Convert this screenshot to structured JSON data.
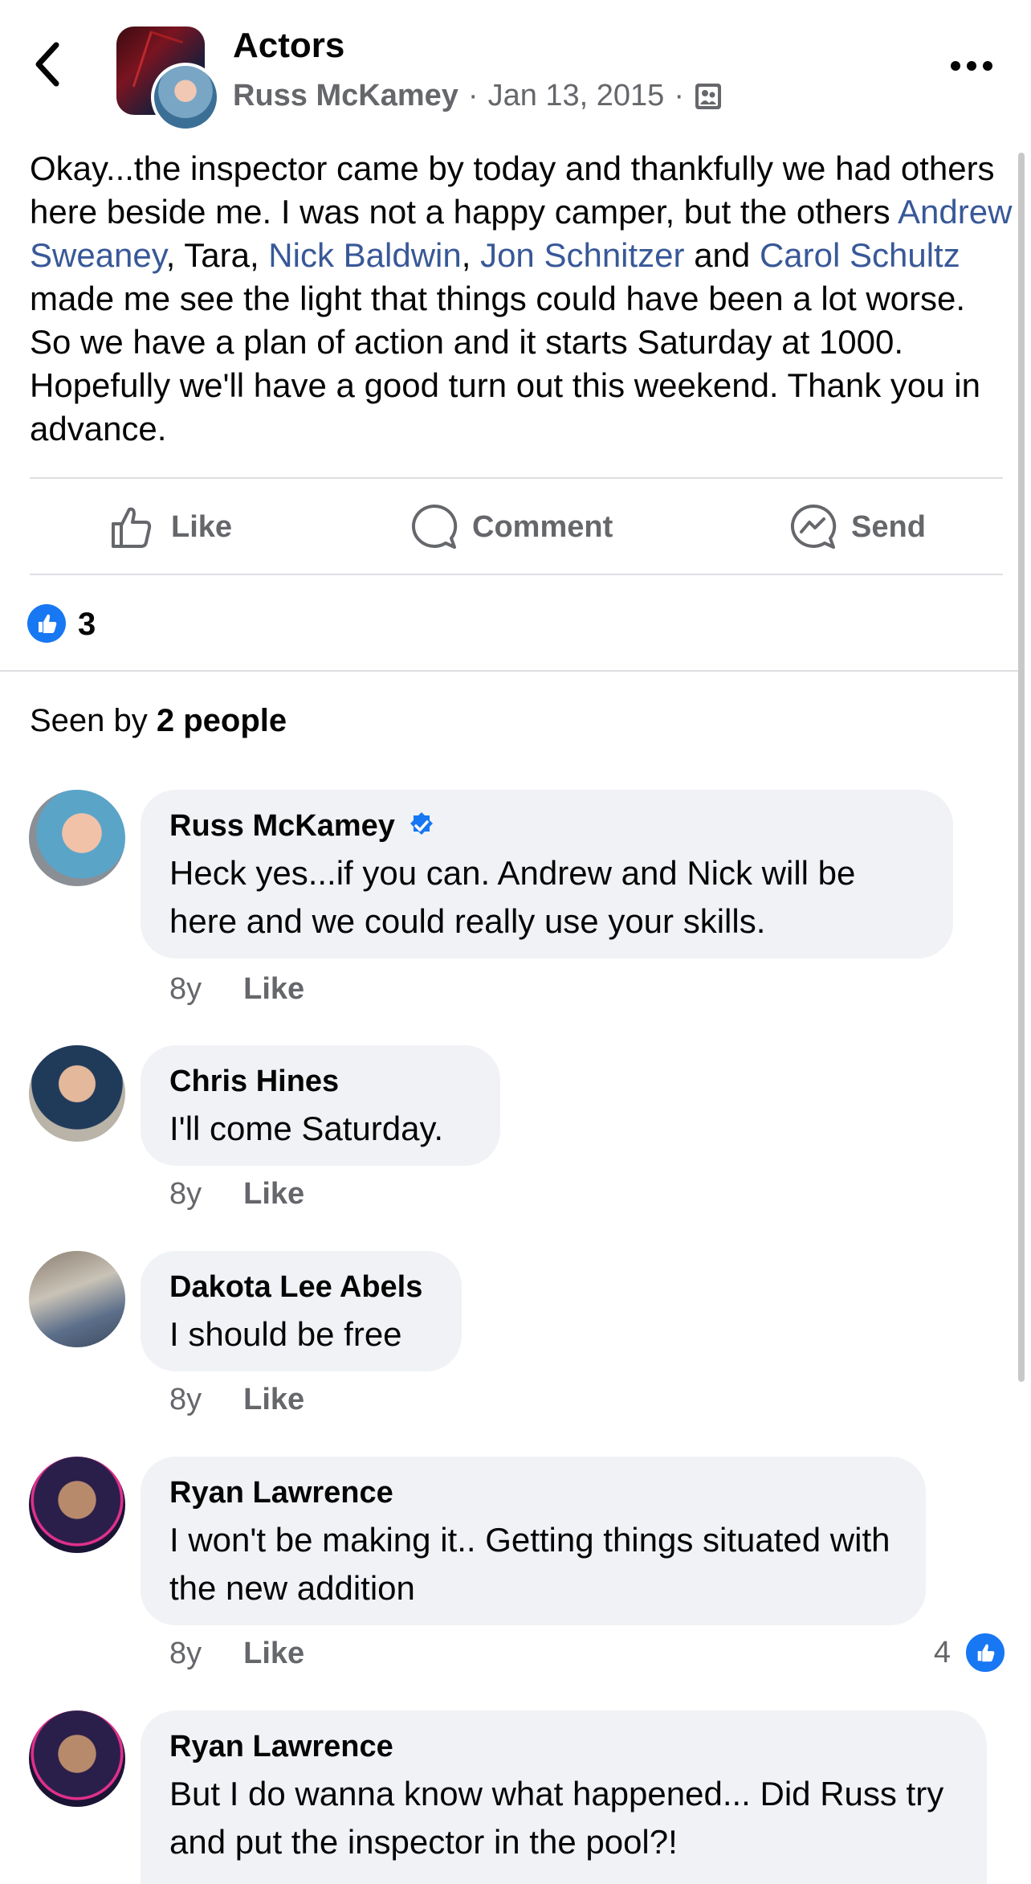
{
  "header": {
    "group_name": "Actors",
    "author": "Russ McKamey",
    "date": "Jan 13, 2015",
    "privacy_icon": "group-audience-icon"
  },
  "post": {
    "text_1": "Okay...the inspector came by today and thankfully we had others here beside me. I was not a happy camper, but the others ",
    "mention_1": "Andrew Sweaney",
    "text_2": ", Tara, ",
    "mention_2": "Nick Baldwin",
    "text_3": ",  ",
    "mention_3": "Jon Schnitzer",
    "text_4": " and ",
    "mention_4": "Carol Schultz",
    "text_5": " made me see the light that things could have been a lot worse. So we have a plan of action and it starts Saturday at 1000. Hopefully we'll have a good turn out this weekend. Thank you in advance."
  },
  "actions": {
    "like": "Like",
    "comment": "Comment",
    "send": "Send"
  },
  "reactions": {
    "count": "3"
  },
  "seen": {
    "prefix": "Seen by ",
    "count": "2 people"
  },
  "comments": [
    {
      "name": "Russ McKamey",
      "verified": true,
      "text": "Heck yes...if you can. Andrew and Nick will be here and we could really use your skills.",
      "age": "8y",
      "like": "Like"
    },
    {
      "name": "Chris Hines",
      "text": "I'll come Saturday.",
      "age": "8y",
      "like": "Like"
    },
    {
      "name": "Dakota Lee Abels",
      "text": "I should be free",
      "age": "8y",
      "like": "Like"
    },
    {
      "name": "Ryan Lawrence",
      "text": "I won't be making it.. Getting things situated with the new addition",
      "age": "8y",
      "like": "Like",
      "reaction_count": "4"
    },
    {
      "name": "Ryan Lawrence",
      "text": "But I do wanna know what happened... Did Russ try and put the inspector in the pool?!"
    }
  ],
  "colors": {
    "accent": "#1877f2",
    "mention": "#385898",
    "muted": "#65676b",
    "bubble": "#f0f2f5"
  }
}
